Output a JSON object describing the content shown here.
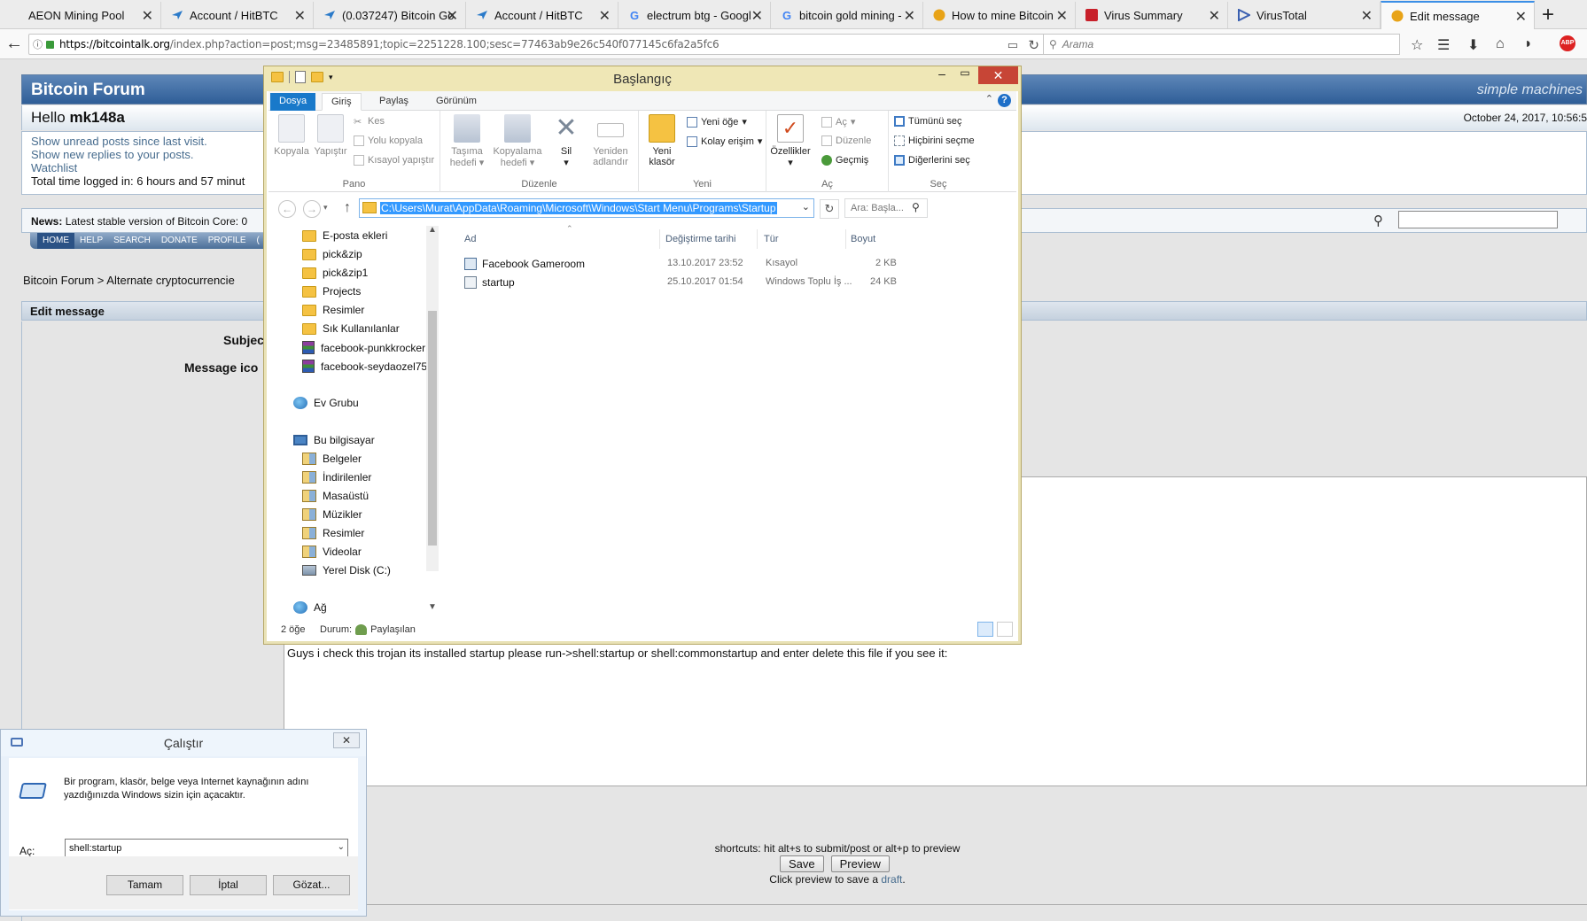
{
  "browser": {
    "tabs": [
      {
        "title": "AEON Mining Pool",
        "icon": "aeon-icon",
        "active": false
      },
      {
        "title": "Account / HitBTC",
        "icon": "hitbtc-icon",
        "active": false
      },
      {
        "title": "(0.037247) Bitcoin Go",
        "icon": "hitbtc-icon",
        "active": false
      },
      {
        "title": "Account / HitBTC",
        "icon": "hitbtc-icon",
        "active": false
      },
      {
        "title": "electrum btg - Googl",
        "icon": "google-icon",
        "active": false
      },
      {
        "title": "bitcoin gold mining -",
        "icon": "google-icon",
        "active": false
      },
      {
        "title": "How to mine Bitcoin",
        "icon": "bitcoin-icon",
        "active": false
      },
      {
        "title": "Virus Summary",
        "icon": "virus-summary-icon",
        "active": false
      },
      {
        "title": "VirusTotal",
        "icon": "virustotal-icon",
        "active": false
      },
      {
        "title": "Edit message",
        "icon": "bitcointalk-icon",
        "active": true
      }
    ],
    "url_host": "https://bitcointalk.org",
    "url_path": "/index.php?action=post;msg=23485891;topic=2251228.100;sesc=77463ab9e26c540f077145c6fa2a5fc6",
    "search_placeholder": "Arama",
    "abp_label": "ABP"
  },
  "forum": {
    "title": "Bitcoin Forum",
    "logo_text": "simple machines",
    "hello_prefix": "Hello",
    "username": "mk148a",
    "datetime": "October 24, 2017, 10:56:5",
    "links": [
      "Show unread posts since last visit.",
      "Show new replies to your posts.",
      "Watchlist"
    ],
    "time_logged": "Total time logged in: 6 hours and 57 minut",
    "news_label": "News:",
    "news_text": "Latest stable version of Bitcoin Core: 0",
    "menu": [
      "HOME",
      "HELP",
      "SEARCH",
      "DONATE",
      "PROFILE",
      "("
    ],
    "breadcrumb": "Bitcoin Forum > Alternate cryptocurrencie",
    "edit_header": "Edit message",
    "subject_label": "Subjec",
    "message_icon_label": "Message ico",
    "message_text": "Guys i check this trojan its installed startup please run->shell:startup or shell:commonstartup and enter delete this file if you see it:",
    "shortcuts": "shortcuts: hit alt+s to submit/post or alt+p to preview",
    "save_label": "Save",
    "preview_label": "Preview",
    "draft_prefix": "Click preview to save a",
    "draft_link": "draft",
    "draft_suffix": "."
  },
  "explorer": {
    "title": "Başlangıç",
    "ribbon_tabs": [
      "Dosya",
      "Giriş",
      "Paylaş",
      "Görünüm"
    ],
    "groups": {
      "pano": {
        "label": "Pano",
        "copy": "Kopyala",
        "paste": "Yapıştır",
        "cut": "Kes",
        "copy_path": "Yolu kopyala",
        "paste_shortcut": "Kısayol yapıştır"
      },
      "duzenle": {
        "label": "Düzenle",
        "move_to": "Taşıma hedefi",
        "copy_to": "Kopyalama hedefi",
        "delete": "Sil",
        "rename": "Yeniden adlandır"
      },
      "yeni": {
        "label": "Yeni",
        "new_folder": "Yeni klasör",
        "new_item": "Yeni öğe",
        "easy_access": "Kolay erişim"
      },
      "ac": {
        "label": "Aç",
        "properties": "Özellikler",
        "open": "Aç",
        "edit": "Düzenle",
        "history": "Geçmiş"
      },
      "sec": {
        "label": "Seç",
        "select_all": "Tümünü seç",
        "select_none": "Hiçbirini seçme",
        "invert": "Diğerlerini seç"
      }
    },
    "address": "C:\\Users\\Murat\\AppData\\Roaming\\Microsoft\\Windows\\Start Menu\\Programs\\Startup",
    "search_placeholder": "Ara: Başla...",
    "tree": [
      {
        "label": "E-posta ekleri",
        "icon": "folder-icon"
      },
      {
        "label": "pick&zip",
        "icon": "folder-icon"
      },
      {
        "label": "pick&zip1",
        "icon": "folder-icon"
      },
      {
        "label": "Projects",
        "icon": "folder-icon"
      },
      {
        "label": "Resimler",
        "icon": "folder-icon"
      },
      {
        "label": "Sık Kullanılanlar",
        "icon": "folder-icon"
      },
      {
        "label": "facebook-punkkrocker",
        "icon": "rar-icon"
      },
      {
        "label": "facebook-seydaozel75",
        "icon": "rar-icon"
      },
      {
        "label": "Ev Grubu",
        "icon": "homegroup-icon"
      },
      {
        "label": "Bu bilgisayar",
        "icon": "computer-icon"
      },
      {
        "label": "Belgeler",
        "icon": "documents-icon"
      },
      {
        "label": "İndirilenler",
        "icon": "downloads-icon"
      },
      {
        "label": "Masaüstü",
        "icon": "desktop-icon"
      },
      {
        "label": "Müzikler",
        "icon": "music-icon"
      },
      {
        "label": "Resimler",
        "icon": "pictures-icon"
      },
      {
        "label": "Videolar",
        "icon": "videos-icon"
      },
      {
        "label": "Yerel Disk (C:)",
        "icon": "disk-icon"
      },
      {
        "label": "Ağ",
        "icon": "network-icon"
      }
    ],
    "columns": [
      "Ad",
      "Değiştirme tarihi",
      "Tür",
      "Boyut"
    ],
    "files": [
      {
        "name": "Facebook Gameroom",
        "date": "13.10.2017 23:52",
        "type": "Kısayol",
        "size": "2 KB"
      },
      {
        "name": "startup",
        "date": "25.10.2017 01:54",
        "type": "Windows Toplu İş ...",
        "size": "24 KB"
      }
    ],
    "status_count": "2 öğe",
    "status_label": "Durum:",
    "status_value": "Paylaşılan"
  },
  "run_dialog": {
    "title": "Çalıştır",
    "description": "Bir program, klasör, belge veya Internet kaynağının adını yazdığınızda Windows sizin için açacaktır.",
    "open_label": "Aç:",
    "input_value": "shell:startup",
    "ok_label": "Tamam",
    "cancel_label": "İptal",
    "browse_label": "Gözat..."
  }
}
